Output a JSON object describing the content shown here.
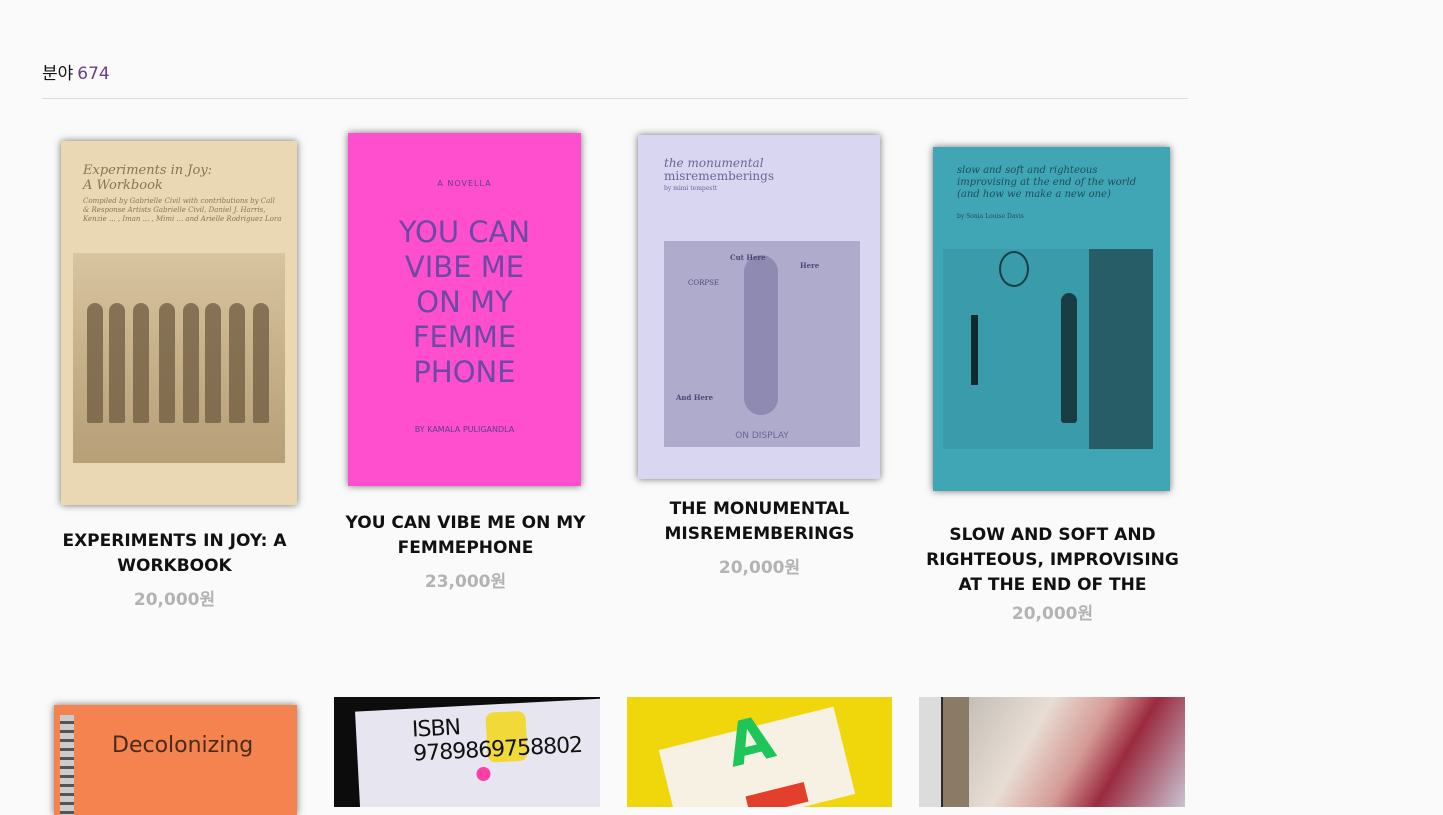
{
  "header": {
    "label": "분야",
    "count": "674"
  },
  "products": [
    {
      "title": "EXPERIMENTS IN JOY: A WORKBOOK",
      "price": "20,000원",
      "cover": {
        "line1": "Experiments in Joy:",
        "line2": "A Workbook",
        "credits": "Compiled by Gabrielle Civil with contributions by Call & Response Artists Gabrielle Civil, Daniel J. Harris, Kenzie ... , Iman ... , Mimi ... and Arielle Rodriguez Lora"
      }
    },
    {
      "title": "YOU CAN VIBE ME ON MY FEMMEPHONE",
      "price": "23,000원",
      "cover": {
        "kicker": "A NOVELLA",
        "big": "YOU CAN VIBE ME ON MY FEMME PHONE",
        "byline": "BY KAMALA PULIGANDLA"
      }
    },
    {
      "title": "THE MONUMENTAL MISREMEMBERINGS",
      "price": "20,000원",
      "cover": {
        "line1": "the monumental",
        "line2": "misrememberings",
        "byline": "by mimi tempestt",
        "label_cut": "Cut Here",
        "label_here": "Here",
        "label_and": "And Here",
        "label_corpse": "CORPSE",
        "label_display": "ON DISPLAY"
      }
    },
    {
      "title": "SLOW AND SOFT AND RIGHTEOUS, IMPROVISING AT THE END OF THE WORLD (A···",
      "price": "20,000원",
      "cover": {
        "line1": "slow and soft and righteous",
        "line2": "improvising at the end of the world",
        "line3": "(and how we make a new one)",
        "byline": "by Sonia Louise Davis"
      }
    }
  ],
  "bottom_row": [
    {
      "cover_text": "Decolonizing"
    },
    {
      "cover_text": "ISBN 9789869758802"
    },
    {
      "cover_text": "A"
    },
    {
      "cover_text": ""
    }
  ],
  "colors": {
    "accent": "#6a3d8f",
    "price": "#b3b3b3",
    "divider": "#dcdcdc"
  }
}
